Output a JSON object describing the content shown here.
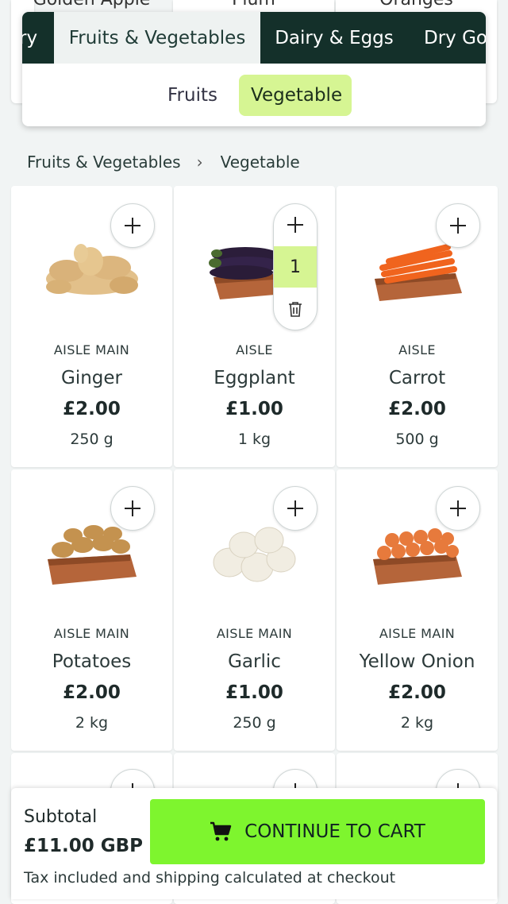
{
  "peek_cards": [
    "Golden Apple",
    "Plum",
    "Oranges"
  ],
  "categories": {
    "tabs": [
      "ry",
      "Fruits & Vegetables",
      "Dairy & Eggs",
      "Dry Go"
    ],
    "active": "Fruits & Vegetables"
  },
  "sub_categories": {
    "tabs": [
      "Fruits",
      "Vegetable"
    ],
    "active": "Vegetable"
  },
  "breadcrumb": {
    "items": [
      "Fruits & Vegetables",
      "Vegetable"
    ],
    "separator": "›"
  },
  "products": [
    {
      "aisle": "AISLE MAIN",
      "name": "Ginger",
      "price": "£2.00",
      "size": "250 g",
      "in_cart": false
    },
    {
      "aisle": "AISLE",
      "name": "Eggplant",
      "price": "£1.00",
      "size": "1 kg",
      "in_cart": true,
      "quantity": "1"
    },
    {
      "aisle": "AISLE",
      "name": "Carrot",
      "price": "£2.00",
      "size": "500 g",
      "in_cart": false
    },
    {
      "aisle": "AISLE MAIN",
      "name": "Potatoes",
      "price": "£2.00",
      "size": "2 kg",
      "in_cart": false
    },
    {
      "aisle": "AISLE MAIN",
      "name": "Garlic",
      "price": "£1.00",
      "size": "250 g",
      "in_cart": false
    },
    {
      "aisle": "AISLE MAIN",
      "name": "Yellow Onion",
      "price": "£2.00",
      "size": "2 kg",
      "in_cart": false
    }
  ],
  "icons": {
    "add": "plus-icon",
    "remove": "trash-icon",
    "cart": "cart-icon"
  },
  "bottom_bar": {
    "subtotal_label": "Subtotal",
    "subtotal_value": "£11.00 GBP",
    "cta_label": "CONTINUE TO CART",
    "tax_note": "Tax included and shipping calculated at checkout"
  },
  "colors": {
    "header_dark": "#14302a",
    "accent_light_green": "#d6f593",
    "cta_green": "#7ef52e",
    "background": "#f1f4f4"
  }
}
